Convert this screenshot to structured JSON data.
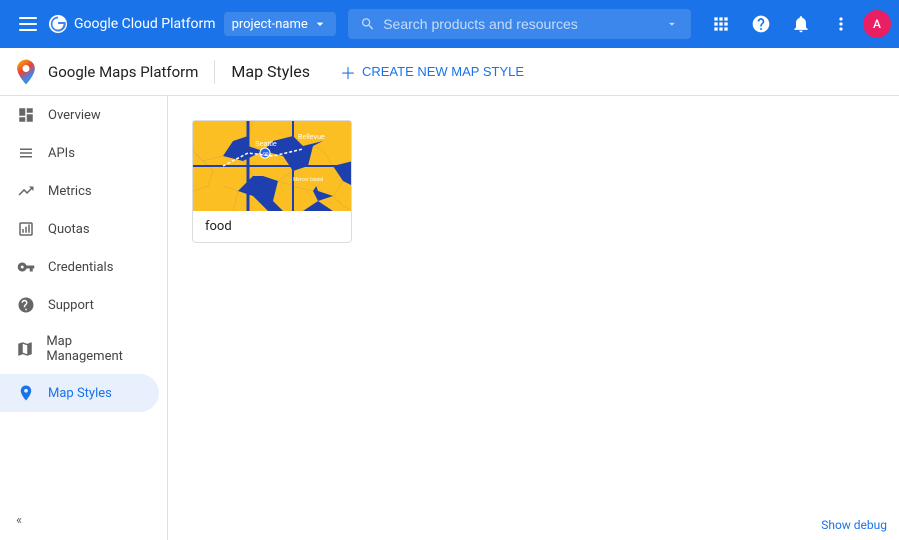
{
  "topBar": {
    "menuIcon": "☰",
    "logoText": "Google Cloud Platform",
    "projectName": "project-name",
    "searchPlaceholder": "Search products and resources",
    "icons": {
      "grid": "⊞",
      "help": "?",
      "bell": "🔔",
      "more": "⋮"
    },
    "avatarLabel": "A"
  },
  "subHeader": {
    "productTitle": "Google Maps Platform",
    "pageTitle": "Map Styles",
    "createButton": "CREATE NEW MAP STYLE"
  },
  "sidebar": {
    "items": [
      {
        "id": "overview",
        "label": "Overview",
        "iconUnicode": "⊟",
        "active": false
      },
      {
        "id": "apis",
        "label": "APIs",
        "iconUnicode": "≡",
        "active": false
      },
      {
        "id": "metrics",
        "label": "Metrics",
        "iconUnicode": "↑",
        "active": false
      },
      {
        "id": "quotas",
        "label": "Quotas",
        "iconUnicode": "▣",
        "active": false
      },
      {
        "id": "credentials",
        "label": "Credentials",
        "iconUnicode": "⚿",
        "active": false
      },
      {
        "id": "support",
        "label": "Support",
        "iconUnicode": "👤",
        "active": false
      },
      {
        "id": "map-management",
        "label": "Map Management",
        "iconUnicode": "▦",
        "active": false
      },
      {
        "id": "map-styles",
        "label": "Map Styles",
        "iconUnicode": "◎",
        "active": true
      }
    ],
    "collapseIcon": "«"
  },
  "content": {
    "mapStyleCards": [
      {
        "id": "food",
        "label": "food",
        "thumbnail": "seattle-map"
      }
    ]
  },
  "footer": {
    "showDebug": "Show debug"
  }
}
